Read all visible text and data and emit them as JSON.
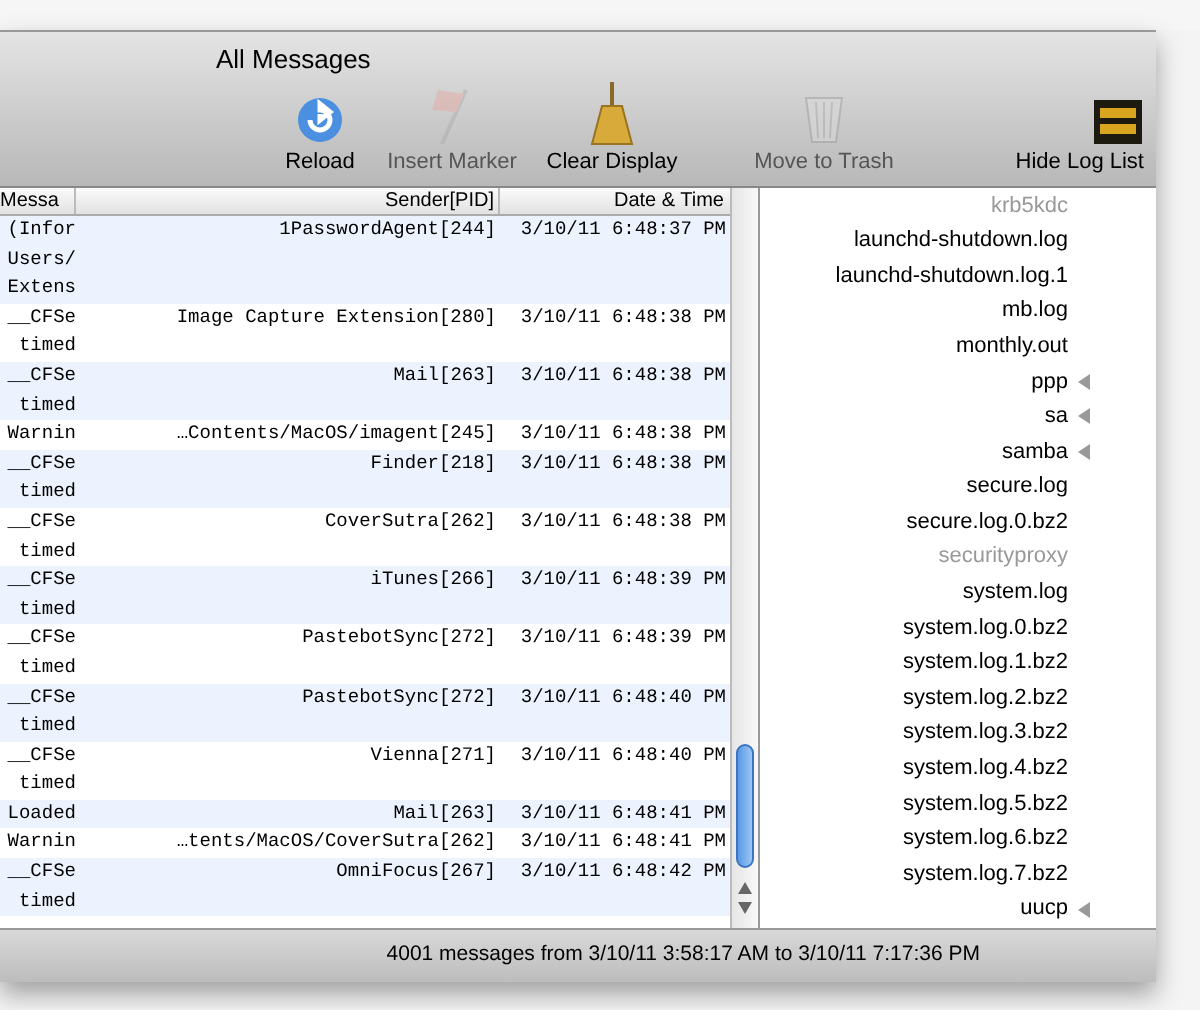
{
  "window": {
    "title": "All Messages"
  },
  "toolbar": [
    {
      "label": "Reload",
      "disabled": false
    },
    {
      "label": "Insert Marker",
      "disabled": true
    },
    {
      "label": "Clear Display",
      "disabled": false
    },
    {
      "label": "Move to Trash",
      "disabled": true
    },
    {
      "label": "Hide Log List",
      "disabled": false
    }
  ],
  "table": {
    "columns": [
      "Messa",
      "Sender[PID]",
      "Date & Time"
    ],
    "rows": [
      {
        "date": "3/10/11 6:48:37 PM",
        "sender": "1PasswordAgent[244]",
        "message": [
          "(Infor",
          "Users/",
          "Extens"
        ]
      },
      {
        "date": "3/10/11 6:48:38 PM",
        "sender": "Image Capture Extension[280]",
        "message": [
          "__CFSe",
          "timed"
        ]
      },
      {
        "date": "3/10/11 6:48:38 PM",
        "sender": "Mail[263]",
        "message": [
          "__CFSe",
          "timed"
        ]
      },
      {
        "date": "3/10/11 6:48:38 PM",
        "sender": "…Contents/MacOS/imagent[245]",
        "message": [
          "Warnin"
        ]
      },
      {
        "date": "3/10/11 6:48:38 PM",
        "sender": "Finder[218]",
        "message": [
          "__CFSe",
          "timed"
        ]
      },
      {
        "date": "3/10/11 6:48:38 PM",
        "sender": "CoverSutra[262]",
        "message": [
          "__CFSe",
          "timed"
        ]
      },
      {
        "date": "3/10/11 6:48:39 PM",
        "sender": "iTunes[266]",
        "message": [
          "__CFSe",
          "timed"
        ]
      },
      {
        "date": "3/10/11 6:48:39 PM",
        "sender": "PastebotSync[272]",
        "message": [
          "__CFSe",
          "timed"
        ]
      },
      {
        "date": "3/10/11 6:48:40 PM",
        "sender": "PastebotSync[272]",
        "message": [
          "__CFSe",
          "timed"
        ]
      },
      {
        "date": "3/10/11 6:48:40 PM",
        "sender": "Vienna[271]",
        "message": [
          "__CFSe",
          "timed"
        ]
      },
      {
        "date": "3/10/11 6:48:41 PM",
        "sender": "Mail[263]",
        "message": [
          "Loaded"
        ]
      },
      {
        "date": "3/10/11 6:48:41 PM",
        "sender": "…tents/MacOS/CoverSutra[262]",
        "message": [
          "Warnin"
        ]
      },
      {
        "date": "3/10/11 6:48:42 PM",
        "sender": "OmniFocus[267]",
        "message": [
          "__CFSe",
          "timed"
        ]
      }
    ]
  },
  "log_list": [
    {
      "name": "krb5kdc",
      "kind": "file",
      "disabled": true
    },
    {
      "name": "launchd-shutdown.log",
      "kind": "file",
      "disabled": false
    },
    {
      "name": "launchd-shutdown.log.1",
      "kind": "file",
      "disabled": false
    },
    {
      "name": "mb.log",
      "kind": "file",
      "disabled": false
    },
    {
      "name": "monthly.out",
      "kind": "file",
      "disabled": false
    },
    {
      "name": "ppp",
      "kind": "folder",
      "disabled": false
    },
    {
      "name": "sa",
      "kind": "folder",
      "disabled": false
    },
    {
      "name": "samba",
      "kind": "folder",
      "disabled": false
    },
    {
      "name": "secure.log",
      "kind": "file",
      "disabled": false
    },
    {
      "name": "secure.log.0.bz2",
      "kind": "file",
      "disabled": false
    },
    {
      "name": "securityproxy",
      "kind": "file",
      "disabled": true
    },
    {
      "name": "system.log",
      "kind": "file",
      "disabled": false
    },
    {
      "name": "system.log.0.bz2",
      "kind": "file",
      "disabled": false
    },
    {
      "name": "system.log.1.bz2",
      "kind": "file",
      "disabled": false
    },
    {
      "name": "system.log.2.bz2",
      "kind": "file",
      "disabled": false
    },
    {
      "name": "system.log.3.bz2",
      "kind": "file",
      "disabled": false
    },
    {
      "name": "system.log.4.bz2",
      "kind": "file",
      "disabled": false
    },
    {
      "name": "system.log.5.bz2",
      "kind": "file",
      "disabled": false
    },
    {
      "name": "system.log.6.bz2",
      "kind": "file",
      "disabled": false
    },
    {
      "name": "system.log.7.bz2",
      "kind": "file",
      "disabled": false
    },
    {
      "name": "uucp",
      "kind": "folder",
      "disabled": false
    }
  ],
  "status_bar": "4001 messages from 3/10/11 3:58:17 AM to 3/10/11 7:17:36 PM"
}
